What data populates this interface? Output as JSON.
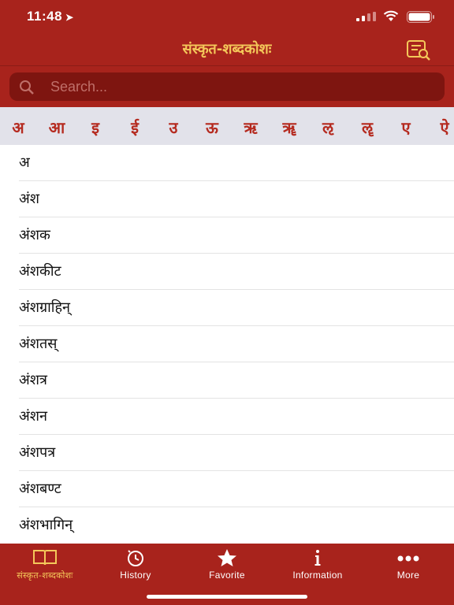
{
  "status": {
    "time": "11:48",
    "location_arrow": "➤"
  },
  "nav": {
    "title": "संस्कृत-शब्दकोशः",
    "search_button_icon": "dictionary-search-icon"
  },
  "search": {
    "placeholder": "Search..."
  },
  "letters": [
    "अ",
    "आ",
    "इ",
    "ई",
    "उ",
    "ऊ",
    "ऋ",
    "ॠ",
    "ऌ",
    "ॡ",
    "ए",
    "ऐ"
  ],
  "words": [
    "अ",
    "अंश",
    "अंशक",
    "अंशकीट",
    "अंशग्राहिन्",
    "अंशतस्",
    "अंशत्र",
    "अंशन",
    "अंशपत्र",
    "अंशबण्ट",
    "अंशभागिन्"
  ],
  "tabs": [
    {
      "label": "संस्कृत-शब्दकोशः",
      "icon": "book-icon",
      "active": true
    },
    {
      "label": "History",
      "icon": "history-icon",
      "active": false
    },
    {
      "label": "Favorite",
      "icon": "star-icon",
      "active": false
    },
    {
      "label": "Information",
      "icon": "info-icon",
      "active": false
    },
    {
      "label": "More",
      "icon": "more-icon",
      "active": false
    }
  ],
  "colors": {
    "primary": "#a8231c",
    "accent": "#f4c85a",
    "letter": "#b52a1f",
    "strip": "#e2e2ea"
  }
}
